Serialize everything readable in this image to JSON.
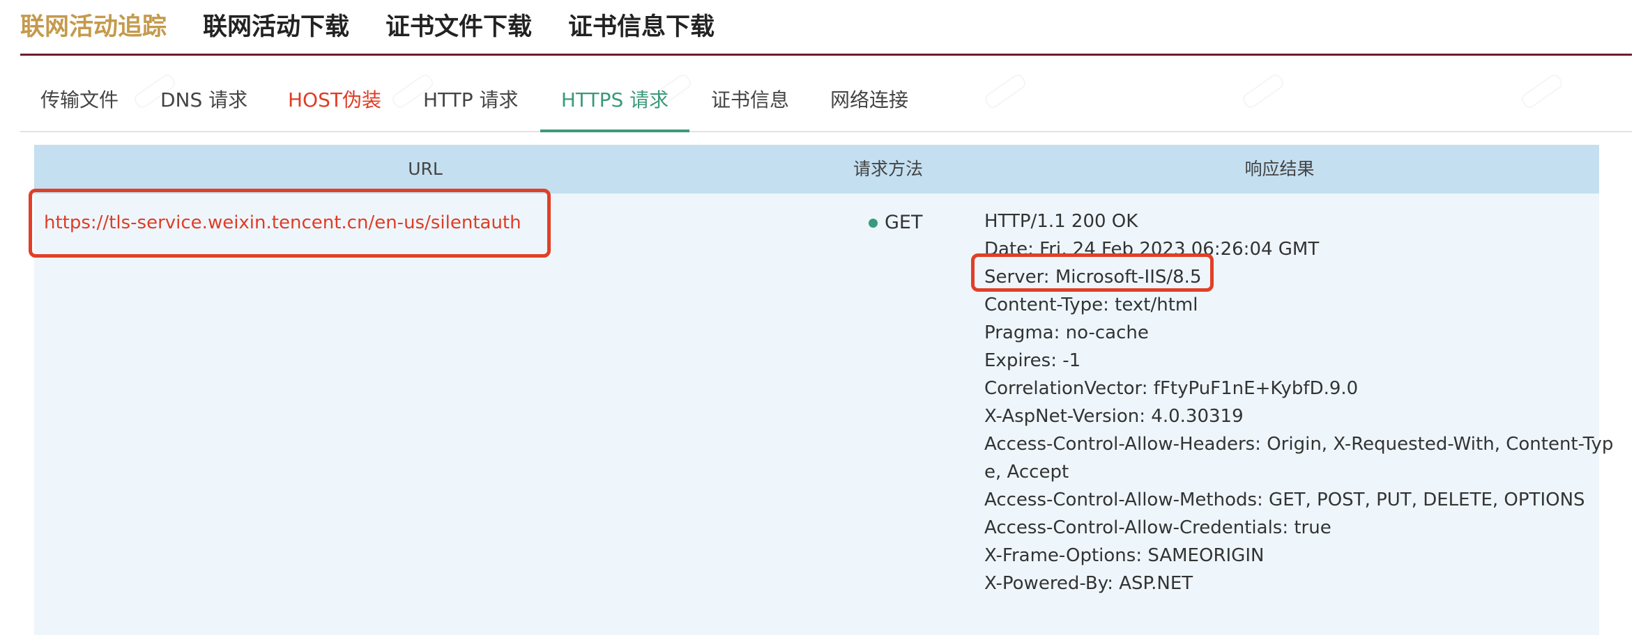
{
  "top_tabs": [
    {
      "label": "联网活动追踪",
      "active": true
    },
    {
      "label": "联网活动下载",
      "active": false
    },
    {
      "label": "证书文件下载",
      "active": false
    },
    {
      "label": "证书信息下载",
      "active": false
    }
  ],
  "sub_tabs": [
    {
      "label": "传输文件"
    },
    {
      "label": "DNS 请求"
    },
    {
      "label": "HOST伪装"
    },
    {
      "label": "HTTP 请求"
    },
    {
      "label": "HTTPS 请求"
    },
    {
      "label": "证书信息"
    },
    {
      "label": "网络连接"
    }
  ],
  "active_sub_tab": "HTTPS 请求",
  "table": {
    "headers": {
      "url": "URL",
      "method": "请求方法",
      "response": "响应结果"
    },
    "rows": [
      {
        "url": "https://tls-service.weixin.tencent.cn/en-us/silentauth",
        "method": "GET",
        "response_lines": [
          "HTTP/1.1 200 OK",
          "Date: Fri, 24 Feb 2023 06:26:04 GMT",
          "Server: Microsoft-IIS/8.5",
          "Content-Type: text/html",
          "Pragma: no-cache",
          "Expires: -1",
          "CorrelationVector: fFtyPuF1nE+KybfD.9.0",
          "X-AspNet-Version: 4.0.30319",
          "Access-Control-Allow-Headers: Origin, X-Requested-With, Content-Type, Accept",
          "Access-Control-Allow-Methods: GET, POST, PUT, DELETE, OPTIONS",
          "Access-Control-Allow-Credentials: true",
          "X-Frame-Options: SAMEORIGIN",
          "X-Powered-By: ASP.NET"
        ]
      }
    ]
  },
  "colors": {
    "active_top_tab": "#c49a4c",
    "top_border": "#6e1e2e",
    "active_sub_tab": "#3a9a7c",
    "warning_text": "#e03c24",
    "header_bg": "#c4dff0",
    "row_bg": "#eef6fc",
    "highlight_box": "#e13f27"
  }
}
